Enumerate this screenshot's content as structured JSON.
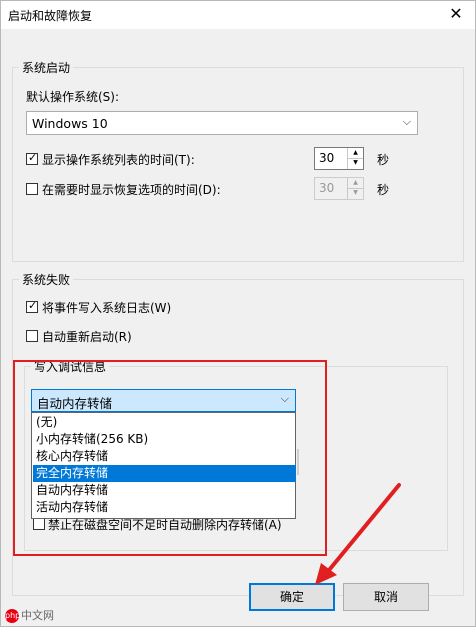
{
  "window": {
    "title": "启动和故障恢复",
    "close_glyph": "✕"
  },
  "system_startup": {
    "group_label": "系统启动",
    "default_os_label": "默认操作系统(S):",
    "default_os_value": "Windows 10",
    "show_list": {
      "checked": true,
      "label": "显示操作系统列表的时间(T):",
      "value": "30",
      "unit": "秒"
    },
    "show_recovery": {
      "checked": false,
      "label": "在需要时显示恢复选项的时间(D):",
      "value": "30",
      "unit": "秒"
    }
  },
  "system_failure": {
    "group_label": "系统失败",
    "write_event": {
      "checked": true,
      "label": "将事件写入系统日志(W)"
    },
    "auto_restart": {
      "checked": false,
      "label": "自动重新启动(R)"
    },
    "debug_group_label": "写入调试信息",
    "dump_selected": "自动内存转储",
    "dump_options": [
      "(无)",
      "小内存转储(256 KB)",
      "核心内存转储",
      "完全内存转储",
      "自动内存转储",
      "活动内存转储"
    ],
    "highlighted_option": "完全内存转储",
    "disable_delete": {
      "checked": false,
      "label": "禁止在磁盘空间不足时自动删除内存转储(A)"
    }
  },
  "buttons": {
    "ok": "确定",
    "cancel": "取消"
  },
  "watermark": {
    "logo": "php",
    "text": "中文网"
  },
  "colors": {
    "selection": "#0078d7",
    "annotation": "#e02020"
  }
}
